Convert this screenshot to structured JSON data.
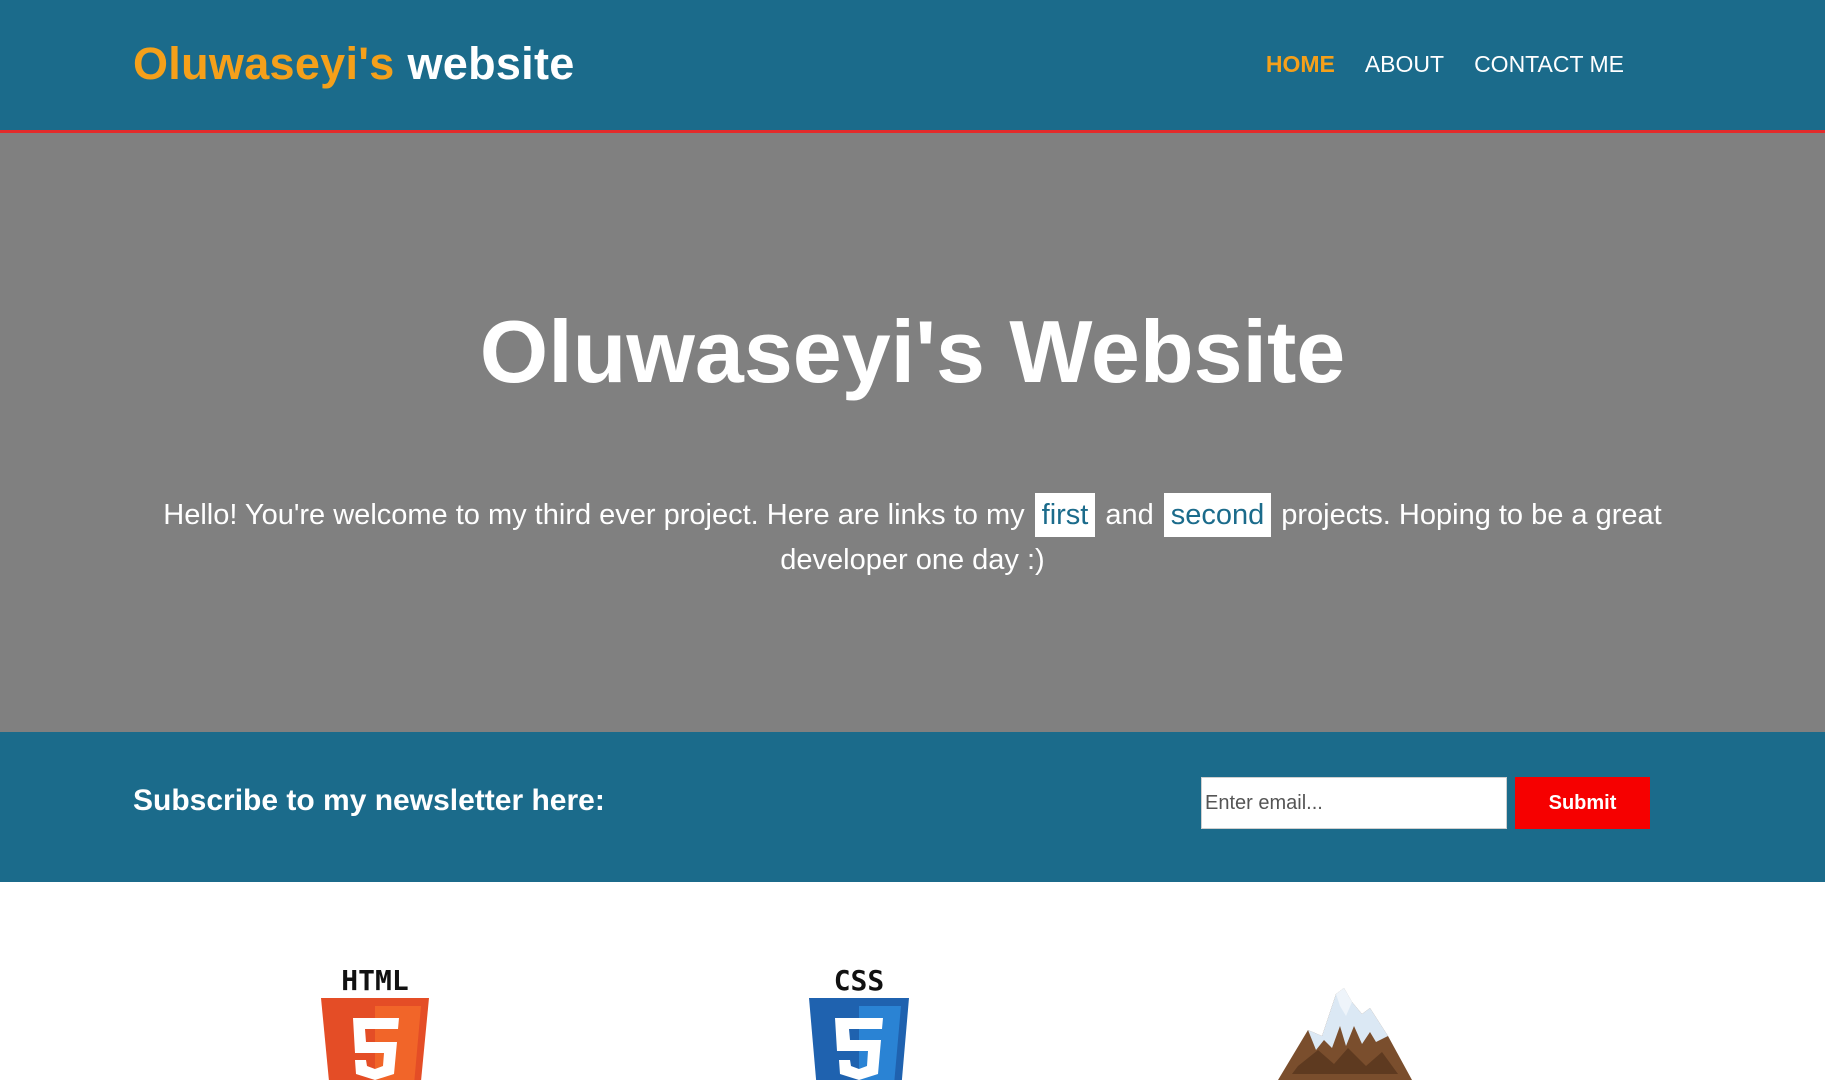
{
  "header": {
    "logo_highlight": "Oluwaseyi's",
    "logo_rest": " website",
    "nav": [
      "HOME",
      "ABOUT",
      "CONTACT ME"
    ],
    "active_nav": "HOME"
  },
  "hero": {
    "title": "Oluwaseyi's Website",
    "text_before": "Hello! You're welcome to my third ever project. Here are links to my",
    "link_first": "first",
    "text_and": "and",
    "link_second": "second",
    "text_after": "projects. Hoping to be a great developer one day :)"
  },
  "newsletter": {
    "heading": "Subscribe to my newsletter here:",
    "email_placeholder": "Enter email...",
    "submit_label": "Submit"
  },
  "logos": {
    "html_label": "HTML",
    "css_label": "CSS"
  },
  "colors": {
    "primary": "#1b6b8b",
    "accent": "#f5a01a",
    "hero_bg": "#808080",
    "submit": "#f60000",
    "header_border": "#e32b2b"
  },
  "icons": [
    "html5-logo-icon",
    "css3-logo-icon",
    "mountain-logo-icon"
  ]
}
